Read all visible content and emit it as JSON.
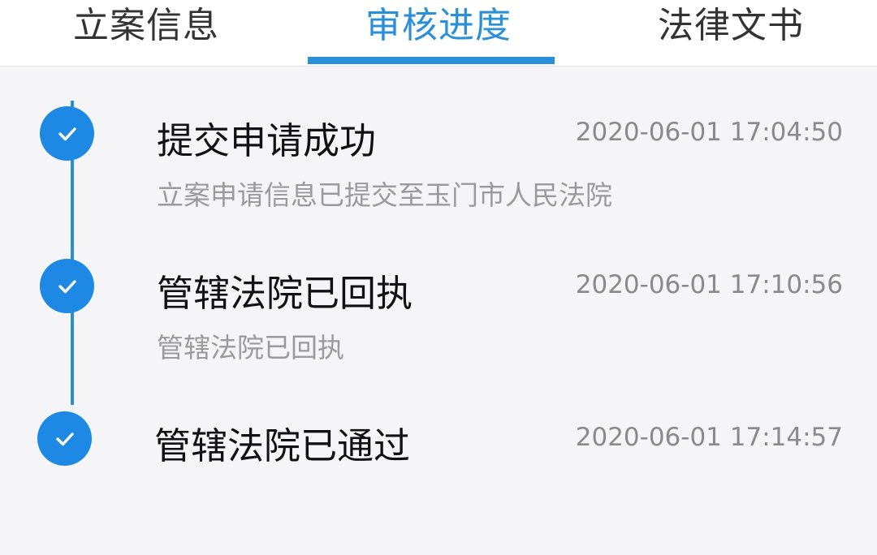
{
  "tabs": [
    {
      "label": "立案信息",
      "active": false
    },
    {
      "label": "审核进度",
      "active": true
    },
    {
      "label": "法律文书",
      "active": false
    }
  ],
  "accent_color": "#2a8fd9",
  "steps": [
    {
      "title": "提交申请成功",
      "time": "2020-06-01 17:04:50",
      "description": "立案申请信息已提交至玉门市人民法院",
      "icon": "check-icon"
    },
    {
      "title": "管辖法院已回执",
      "time": "2020-06-01 17:10:56",
      "description": "管辖法院已回执",
      "icon": "check-icon"
    },
    {
      "title": "管辖法院已通过",
      "time": "2020-06-01 17:14:57",
      "description": "",
      "icon": "check-icon"
    }
  ]
}
